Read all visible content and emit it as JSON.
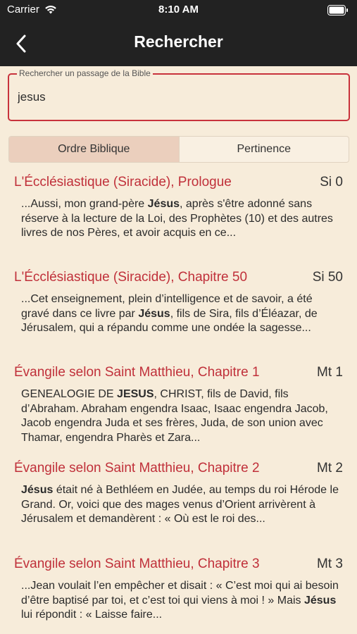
{
  "status_bar": {
    "carrier": "Carrier",
    "time": "8:10 AM"
  },
  "nav": {
    "title": "Rechercher"
  },
  "search": {
    "legend": "Rechercher un passage de la Bible",
    "value": "jesus"
  },
  "segments": [
    {
      "label": "Ordre Biblique",
      "selected": true
    },
    {
      "label": "Pertinence",
      "selected": false
    }
  ],
  "results": [
    {
      "title": "L'Écclésiastique (Siracide), Prologue",
      "ref": "Si 0",
      "snippet": [
        {
          "text": "...Aussi, mon grand-père ",
          "bold": false
        },
        {
          "text": "Jésus",
          "bold": true
        },
        {
          "text": ", après s'être adonné sans réserve à la lecture de la Loi, des Prophètes (10) et des autres livres de nos Pères, et avoir acquis en ce...",
          "bold": false
        }
      ]
    },
    {
      "title": "L'Écclésiastique (Siracide), Chapitre 50",
      "ref": "Si 50",
      "snippet": [
        {
          "text": "...Cet enseignement, plein d’intelligence et de savoir, a été gravé dans ce livre par ",
          "bold": false
        },
        {
          "text": "Jésus",
          "bold": true
        },
        {
          "text": ", fils de Sira, fils d’Éléazar, de Jérusalem, qui a répandu comme une ondée la sagesse...",
          "bold": false
        }
      ]
    },
    {
      "title": "Évangile selon Saint Matthieu, Chapitre 1",
      "ref": "Mt 1",
      "snippet": [
        {
          "text": "GENEALOGIE DE ",
          "bold": false
        },
        {
          "text": "JESUS",
          "bold": true
        },
        {
          "text": ", CHRIST, fils de David, fils d’Abraham. Abraham engendra Isaac, Isaac engendra Jacob, Jacob engendra Juda et ses frères, Juda, de son union avec Thamar, engendra Pharès et Zara...",
          "bold": false
        }
      ]
    },
    {
      "title": "Évangile selon Saint Matthieu, Chapitre 2",
      "ref": "Mt 2",
      "snippet": [
        {
          "text": "Jésus",
          "bold": true
        },
        {
          "text": " était né à Bethléem en Judée, au temps du roi Hérode le Grand. Or, voici que des mages venus d’Orient arrivèrent à Jérusalem et demandèrent : « Où est le roi des...",
          "bold": false
        }
      ]
    },
    {
      "title": "Évangile selon Saint Matthieu, Chapitre 3",
      "ref": "Mt 3",
      "snippet": [
        {
          "text": "...Jean voulait l’en empêcher et disait : « C’est moi qui ai besoin d’être baptisé par toi, et c’est toi qui viens à moi ! » Mais ",
          "bold": false
        },
        {
          "text": "Jésus",
          "bold": true
        },
        {
          "text": " lui répondit : « Laisse faire...",
          "bold": false
        }
      ]
    }
  ],
  "colors": {
    "background": "#f7ecda",
    "nav_background": "#222222",
    "accent_red": "#c0303a",
    "segment_selected": "#ebcfbd"
  },
  "icons": {
    "back": "chevron-left-icon",
    "wifi": "wifi-icon",
    "battery": "battery-icon"
  }
}
